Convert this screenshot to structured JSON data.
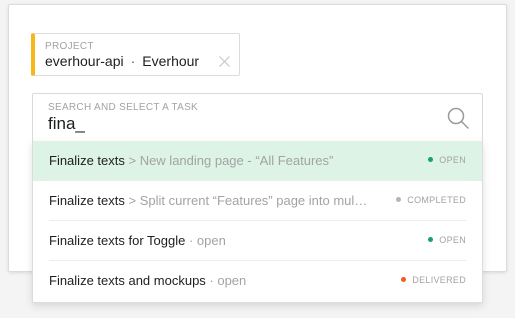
{
  "project": {
    "label": "PROJECT",
    "name": "everhour-api",
    "separator": "·",
    "client": "Everhour",
    "accent_color": "#f7b718",
    "clear_icon": "close-icon"
  },
  "search": {
    "label": "SEARCH AND SELECT A TASK",
    "value": "fina_",
    "icon": "search-icon"
  },
  "tasks": [
    {
      "name": "Finalize texts",
      "context": " > New landing page - “All Features”",
      "status": "OPEN",
      "status_color": "#1a9f72",
      "highlighted": true
    },
    {
      "name": "Finalize texts",
      "context": " > Split current “Features” page into mul…",
      "status": "COMPLETED",
      "status_color": "#b5b5b5",
      "highlighted": false
    },
    {
      "name": "Finalize texts for Toggle",
      "context": " · open",
      "status": "OPEN",
      "status_color": "#1a9f72",
      "highlighted": false
    },
    {
      "name": "Finalize texts and mockups",
      "context": " · open",
      "status": "DELIVERED",
      "status_color": "#ee5a26",
      "highlighted": false
    }
  ]
}
